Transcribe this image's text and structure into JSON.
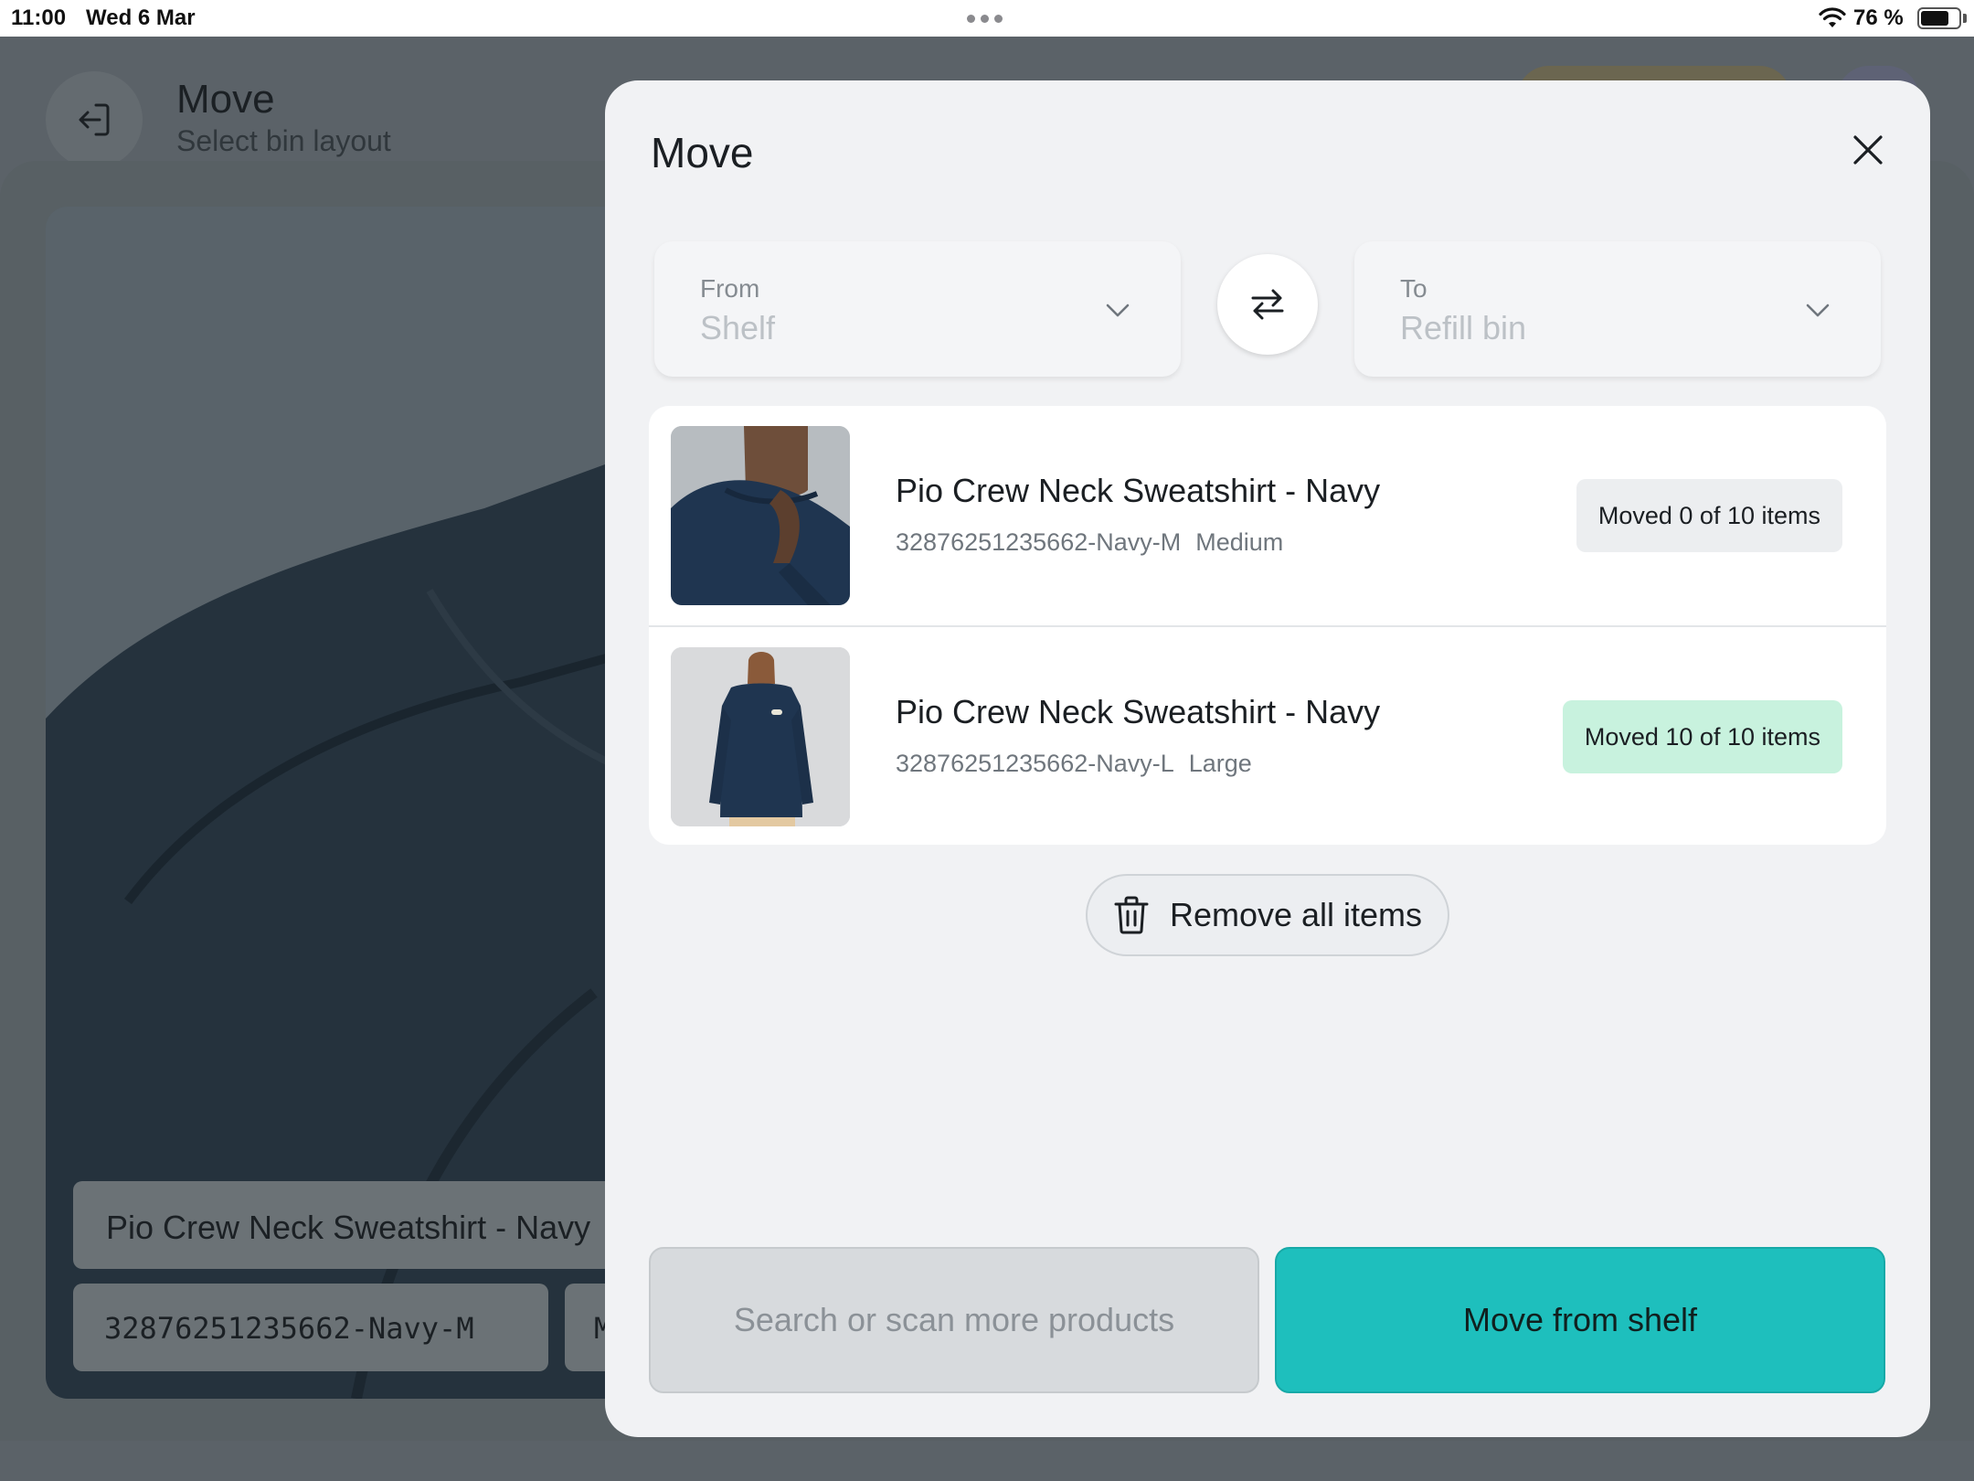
{
  "status_bar": {
    "time": "11:00",
    "date": "Wed 6 Mar",
    "battery_label": "76 %",
    "battery_level": 0.76,
    "icons": [
      "multitasking-dots-icon",
      "wifi-icon",
      "battery-icon"
    ]
  },
  "background": {
    "title": "Move",
    "subtitle": "Select bin layout",
    "back_icon": "exit-icon",
    "product_name": "Pio Crew Neck Sweatshirt - Navy",
    "product_sku": "32876251235662-Navy-M",
    "product_extra": "M"
  },
  "modal": {
    "title": "Move",
    "close_icon": "close-icon",
    "from": {
      "label": "From",
      "value": "Shelf",
      "icon": "chevron-down-icon"
    },
    "swap_icon": "swap-arrows-icon",
    "to": {
      "label": "To",
      "value": "Refill bin",
      "icon": "chevron-down-icon"
    },
    "items": [
      {
        "name": "Pio Crew Neck Sweatshirt - Navy",
        "sku": "32876251235662-Navy-M",
        "size": "Medium",
        "status": "Moved 0 of 10 items",
        "moved": 0,
        "total": 10
      },
      {
        "name": "Pio Crew Neck Sweatshirt - Navy",
        "sku": "32876251235662-Navy-L",
        "size": "Large",
        "status": "Moved 10 of 10 items",
        "moved": 10,
        "total": 10
      }
    ],
    "remove_all": {
      "label": "Remove all items",
      "icon": "trash-icon"
    },
    "search_placeholder": "Search or scan more products",
    "primary_action": "Move from shelf"
  },
  "colors": {
    "accent": "#1ebfbd",
    "success_badge": "#c8f2de",
    "neutral_badge": "#eceef0",
    "overlay": "#5b6268"
  }
}
